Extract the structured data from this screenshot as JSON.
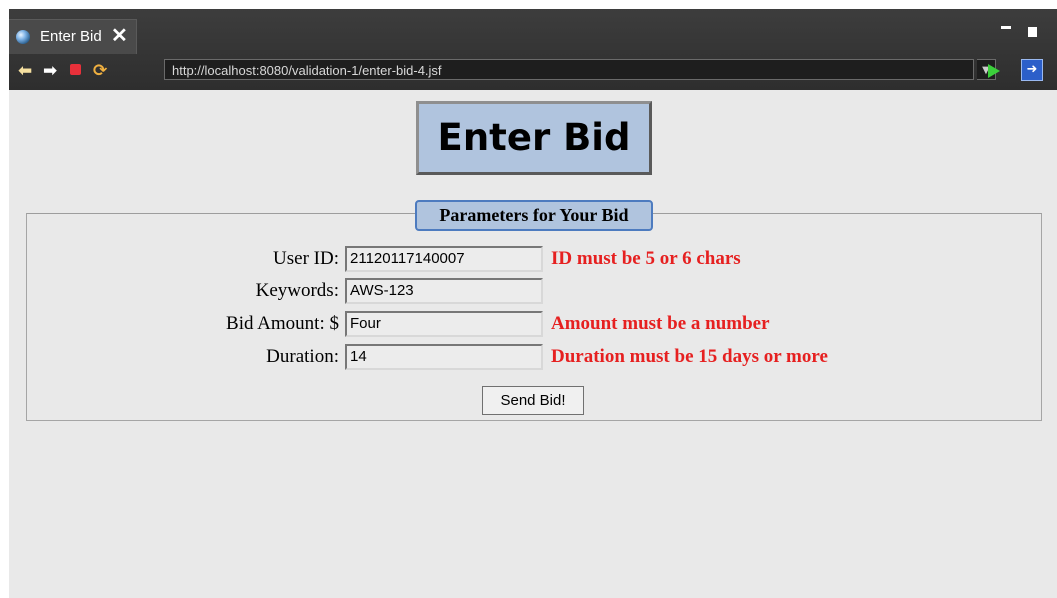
{
  "tab": {
    "title": "Enter Bid",
    "close_glyph": "✕"
  },
  "toolbar": {
    "url": "http://localhost:8080/validation-1/enter-bid-4.jsf",
    "icons": [
      "back-arrow-icon",
      "forward-arrow-icon",
      "stop-icon",
      "refresh-icon",
      "dropdown-chevron-icon",
      "go-icon",
      "external-browser-icon"
    ]
  },
  "page": {
    "heading": "Enter Bid",
    "legend": "Parameters for Your Bid",
    "fields": [
      {
        "label": "User ID:",
        "value": "21120117140007",
        "error": "ID must be 5 or 6 chars"
      },
      {
        "label": "Keywords:",
        "value": "AWS-123",
        "error": ""
      },
      {
        "label": "Bid Amount: $",
        "value": "Four",
        "error": "Amount must be a number"
      },
      {
        "label": "Duration:",
        "value": "14",
        "error": "Duration must be 15 days or more"
      }
    ],
    "submit_label": "Send Bid!"
  },
  "colors": {
    "accent": "#b0c4de",
    "error": "#e62020",
    "legend_border": "#4d7bbf"
  }
}
